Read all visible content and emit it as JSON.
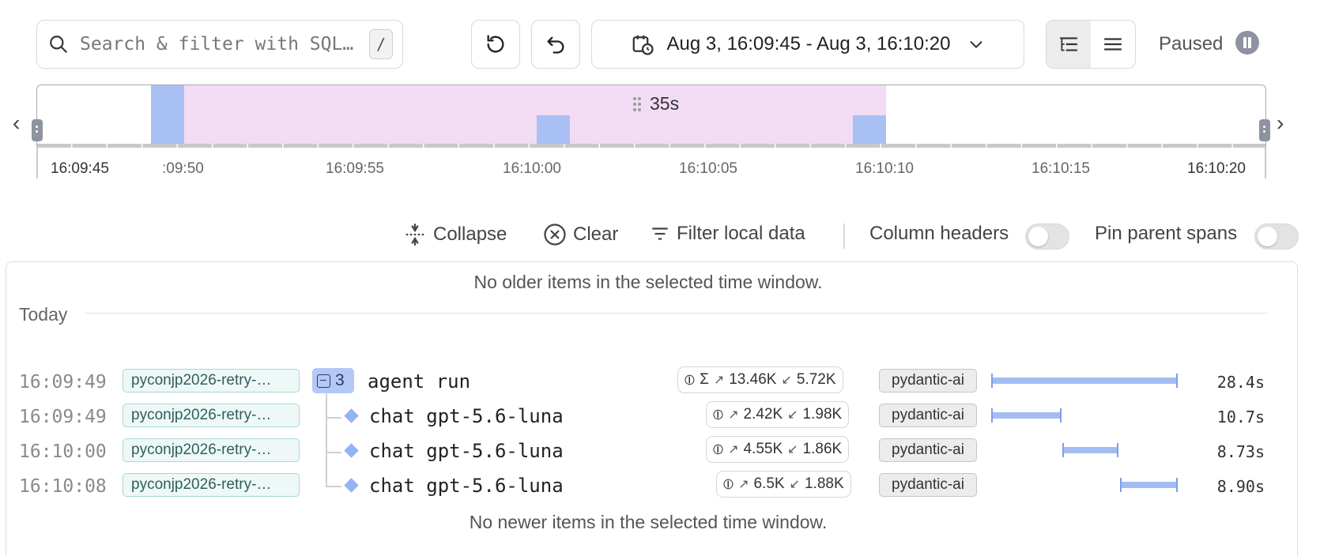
{
  "search": {
    "placeholder": "Search & filter with SQL…",
    "shortcut": "/"
  },
  "header": {
    "date_range": "Aug 3, 16:09:45 - Aug 3, 16:10:20",
    "status": "Paused"
  },
  "timeline": {
    "ticks": [
      "16:09:45",
      ":09:50",
      "16:09:55",
      "16:10:00",
      "16:10:05",
      "16:10:10",
      "16:10:15",
      "16:10:20"
    ],
    "selection_label": "35s"
  },
  "toolbar": {
    "collapse": "Collapse",
    "clear": "Clear",
    "filter": "Filter local data",
    "column_headers": "Column headers",
    "pin_parent": "Pin parent spans"
  },
  "list": {
    "older_notice": "No older items in the selected time window.",
    "newer_notice": "No newer items in the selected time window.",
    "group_label": "Today",
    "rows": [
      {
        "time": "16:09:49",
        "service": "pyconjp2026-retry-…",
        "count": "3",
        "name": "agent run",
        "tokens_in": "13.46K",
        "tokens_out": "5.72K",
        "scope": "pydantic-ai",
        "duration": "28.4s"
      },
      {
        "time": "16:09:49",
        "service": "pyconjp2026-retry-…",
        "name": "chat gpt-5.6-luna",
        "tokens_in": "2.42K",
        "tokens_out": "1.98K",
        "scope": "pydantic-ai",
        "duration": "10.7s"
      },
      {
        "time": "16:10:00",
        "service": "pyconjp2026-retry-…",
        "name": "chat gpt-5.6-luna",
        "tokens_in": "4.55K",
        "tokens_out": "1.86K",
        "scope": "pydantic-ai",
        "duration": "8.73s"
      },
      {
        "time": "16:10:08",
        "service": "pyconjp2026-retry-…",
        "name": "chat gpt-5.6-luna",
        "tokens_in": "6.5K",
        "tokens_out": "1.88K",
        "scope": "pydantic-ai",
        "duration": "8.90s"
      }
    ]
  },
  "colors": {
    "accent": "#a3bdf3",
    "selection": "#f2dcf4",
    "service_tag": "#eef8f7"
  }
}
